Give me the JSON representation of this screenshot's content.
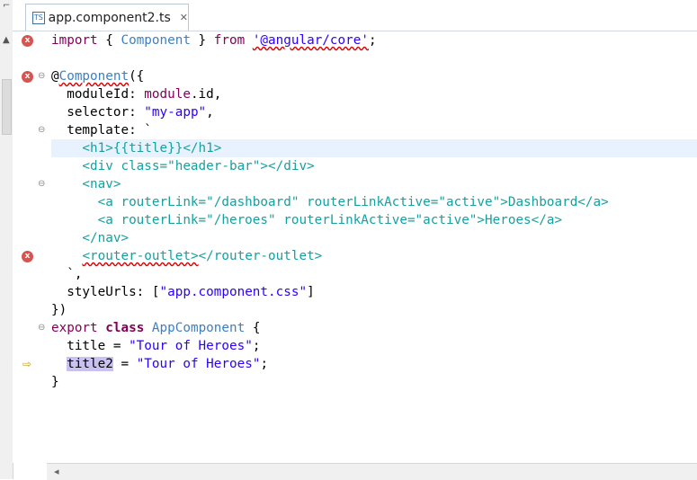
{
  "tab": {
    "icon_text": "TS",
    "label": "app.component2.ts",
    "close": "✕"
  },
  "gutter": {
    "error_glyph": "x",
    "arrow_glyph": "⇨",
    "fold_glyph": "⊖"
  },
  "code": {
    "l1a": "import",
    "l1b": " { ",
    "l1c": "Component",
    "l1d": " } ",
    "l1e": "from",
    "l1f": " ",
    "l1g": "'@angular/core'",
    "l1h": ";",
    "l3a": "@",
    "l3b": "Component",
    "l3c": "({",
    "l4a": "  moduleId: ",
    "l4b": "module",
    "l4c": ".id,",
    "l5a": "  selector: ",
    "l5b": "\"my-app\"",
    "l5c": ",",
    "l6a": "  template: `",
    "l7": "    <h1>{{title}}</h1>",
    "l8": "    <div class=\"header-bar\"></div>",
    "l9": "    <nav>",
    "l10": "      <a routerLink=\"/dashboard\" routerLinkActive=\"active\">Dashboard</a>",
    "l11": "      <a routerLink=\"/heroes\" routerLinkActive=\"active\">Heroes</a>",
    "l12": "    </nav>",
    "l13a": "    ",
    "l13b": "<router-outlet>",
    "l13c": "</router-outlet>",
    "l14a": "  `",
    "l14b": ",",
    "l15a": "  styleUrls: [",
    "l15b": "\"app.component.css\"",
    "l15c": "]",
    "l16": "})",
    "l17a": "export",
    "l17b": " ",
    "l17c": "class",
    "l17d": " ",
    "l17e": "AppComponent",
    "l17f": " {",
    "l18a": "  title = ",
    "l18b": "\"Tour of Heroes\"",
    "l18c": ";",
    "l19a": "  ",
    "l19b": "title2",
    "l19c": " = ",
    "l19d": "\"Tour of Heroes\"",
    "l19e": ";",
    "l20": "}"
  }
}
